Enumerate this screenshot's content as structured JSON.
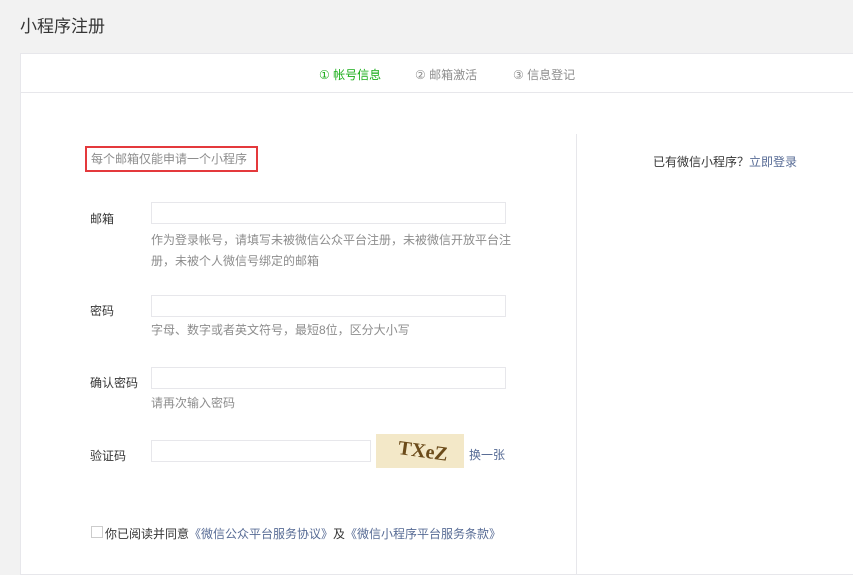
{
  "page": {
    "title": "小程序注册"
  },
  "steps": [
    {
      "label": "① 帐号信息",
      "active": true
    },
    {
      "label": "② 邮箱激活",
      "active": false
    },
    {
      "label": "③ 信息登记",
      "active": false
    }
  ],
  "notice": "每个邮箱仅能申请一个小程序",
  "form": {
    "email": {
      "label": "邮箱",
      "value": "",
      "tip": "作为登录帐号，请填写未被微信公众平台注册，未被微信开放平台注册，未被个人微信号绑定的邮箱"
    },
    "password": {
      "label": "密码",
      "value": "",
      "tip": "字母、数字或者英文符号，最短8位，区分大小写"
    },
    "confirm": {
      "label": "确认密码",
      "value": "",
      "tip": "请再次输入密码"
    },
    "captcha": {
      "label": "验证码",
      "value": "",
      "image_text": "TXeZ",
      "refresh_label": "换一张"
    }
  },
  "agree": {
    "prefix": "你已阅读并同意",
    "link1": "《微信公众平台服务协议》",
    "mid": "及",
    "link2": "《微信小程序平台服务条款》"
  },
  "sidebar": {
    "text": "已有微信小程序？",
    "login_link": "立即登录"
  },
  "colors": {
    "active_step": "#1aad19",
    "link": "#576b95",
    "notice_border": "#e4393c"
  }
}
